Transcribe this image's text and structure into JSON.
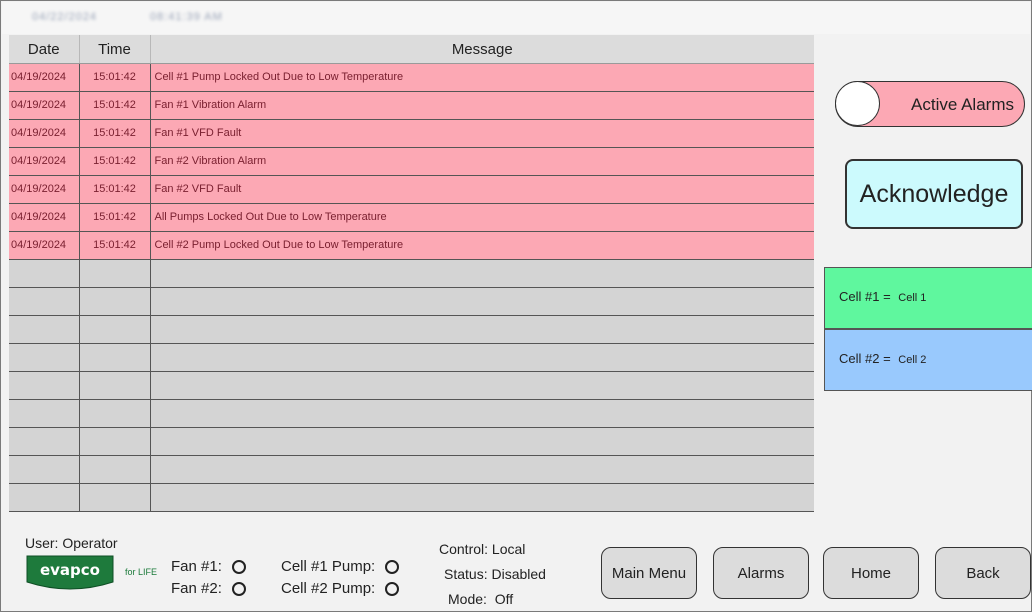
{
  "header": {
    "date": "04/22/2024",
    "time": "08:41:39 AM"
  },
  "alarm_table": {
    "columns": [
      "Date",
      "Time",
      "Message"
    ],
    "rows": [
      {
        "date": "04/19/2024",
        "time": "15:01:42",
        "message": "Cell #1 Pump Locked Out Due to Low Temperature"
      },
      {
        "date": "04/19/2024",
        "time": "15:01:42",
        "message": "Fan #1 Vibration Alarm"
      },
      {
        "date": "04/19/2024",
        "time": "15:01:42",
        "message": "Fan #1 VFD Fault"
      },
      {
        "date": "04/19/2024",
        "time": "15:01:42",
        "message": "Fan #2 Vibration Alarm"
      },
      {
        "date": "04/19/2024",
        "time": "15:01:42",
        "message": "Fan #2 VFD Fault"
      },
      {
        "date": "04/19/2024",
        "time": "15:01:42",
        "message": "All Pumps Locked Out Due to Low Temperature"
      },
      {
        "date": "04/19/2024",
        "time": "15:01:42",
        "message": "Cell #2 Pump Locked Out Due to Low Temperature"
      }
    ]
  },
  "right_panel": {
    "active_alarms_label": "Active Alarms",
    "acknowledge_label": "Acknowledge",
    "cell1_label": "Cell #1 =",
    "cell1_name": "Cell 1",
    "cell2_label": "Cell #2 =",
    "cell2_name": "Cell 2"
  },
  "footer": {
    "user_label": "User: Operator",
    "logo_text": "evapco",
    "logo_tagline": "for LIFE",
    "fan1_label": "Fan #1:",
    "fan2_label": "Fan #2:",
    "cell1_pump_label": "Cell #1 Pump:",
    "cell2_pump_label": "Cell #2 Pump:",
    "control": "Control: Local",
    "status": "Status: Disabled",
    "mode": "Mode:  Off"
  },
  "nav": {
    "main_menu": "Main Menu",
    "alarms": "Alarms",
    "home": "Home",
    "back": "Back"
  },
  "colors": {
    "active_alarm_row": "#fca8b4",
    "acknowledge": "#ccfafd",
    "cell1": "#5ff79e",
    "cell2": "#99c9fd",
    "empty_row": "#d4d4d4",
    "button": "#dcdcdc"
  }
}
